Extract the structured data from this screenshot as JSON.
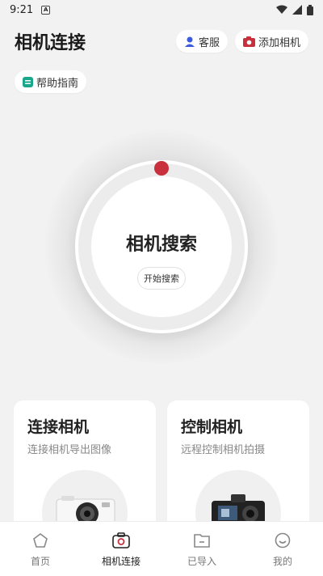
{
  "status": {
    "time": "9:21",
    "a_icon": "A"
  },
  "header": {
    "title": "相机连接",
    "service_label": "客服",
    "add_camera_label": "添加相机",
    "help_label": "帮助指南"
  },
  "dial": {
    "title": "相机搜索",
    "search_button": "开始搜索"
  },
  "cards": {
    "connect": {
      "title": "连接相机",
      "subtitle": "连接相机导出图像"
    },
    "control": {
      "title": "控制相机",
      "subtitle": "远程控制相机拍摄"
    }
  },
  "nav": {
    "home": "首页",
    "camera_connect": "相机连接",
    "imported": "已导入",
    "mine": "我的"
  },
  "colors": {
    "accent": "#c7303c",
    "service_icon": "#3b5bdb",
    "help_icon": "#1aa68a"
  }
}
